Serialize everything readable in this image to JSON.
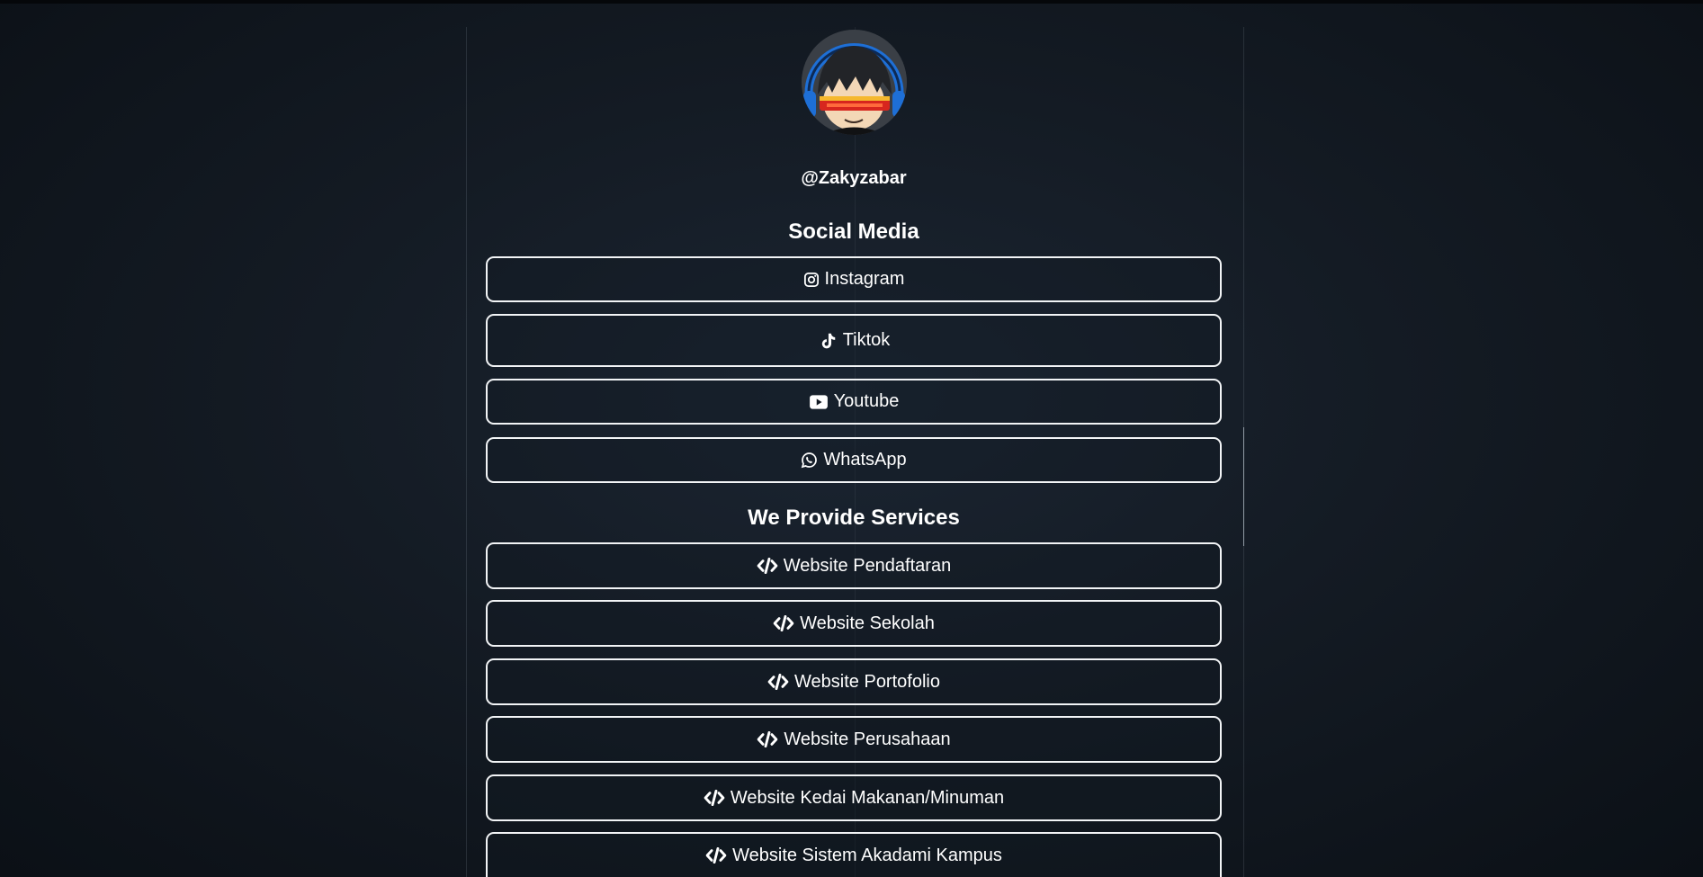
{
  "profile": {
    "username": "@Zakyzabar",
    "avatar_icon": "anime-avatar-with-headphones-and-visor"
  },
  "social_media": {
    "title": "Social Media",
    "links": [
      {
        "label": "Instagram",
        "icon": "instagram-icon"
      },
      {
        "label": "Tiktok",
        "icon": "tiktok-icon"
      },
      {
        "label": "Youtube",
        "icon": "youtube-icon"
      },
      {
        "label": "WhatsApp",
        "icon": "whatsapp-icon"
      }
    ]
  },
  "services": {
    "title": "We Provide Services",
    "links": [
      {
        "label": "Website Pendaftaran",
        "icon": "code-icon"
      },
      {
        "label": "Website Sekolah",
        "icon": "code-icon"
      },
      {
        "label": "Website Portofolio",
        "icon": "code-icon"
      },
      {
        "label": "Website Perusahaan",
        "icon": "code-icon"
      },
      {
        "label": "Website Kedai Makanan/Minuman",
        "icon": "code-icon"
      },
      {
        "label": "Website Sistem Akadami Kampus",
        "icon": "code-icon"
      }
    ]
  },
  "colors": {
    "background": "#141b24",
    "button_border": "#f2f4f6",
    "text": "#ffffff"
  }
}
